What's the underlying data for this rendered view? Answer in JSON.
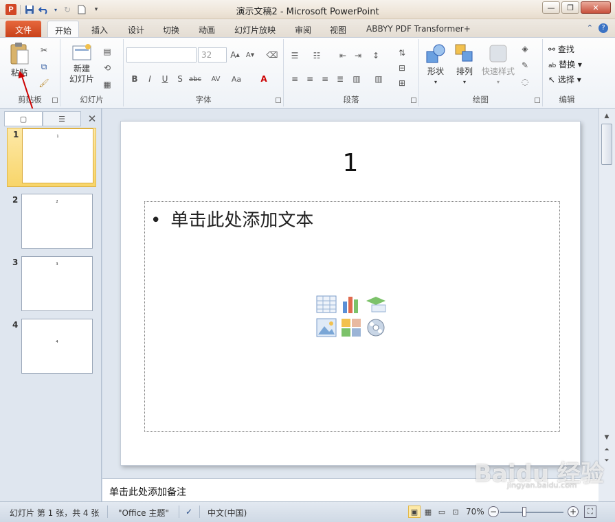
{
  "window": {
    "title": "演示文稿2 - Microsoft PowerPoint",
    "app_icon_letter": "P"
  },
  "tabs": {
    "file": "文件",
    "items": [
      "开始",
      "插入",
      "设计",
      "切换",
      "动画",
      "幻灯片放映",
      "审阅",
      "视图",
      "ABBYY PDF Transformer+"
    ],
    "active": "开始"
  },
  "ribbon": {
    "clipboard": {
      "label": "剪贴板",
      "paste": "粘贴"
    },
    "slides": {
      "label": "幻灯片",
      "new_slide_line1": "新建",
      "new_slide_line2": "幻灯片"
    },
    "font": {
      "label": "字体",
      "font_name": "",
      "font_size": "32"
    },
    "paragraph": {
      "label": "段落"
    },
    "drawing": {
      "label": "绘图",
      "shapes": "形状",
      "arrange": "排列",
      "quick_styles": "快速样式"
    },
    "editing": {
      "label": "编辑",
      "find": "查找",
      "replace": "替换",
      "select": "选择"
    }
  },
  "thumbnails": [
    {
      "num": "1",
      "title": "1",
      "selected": true
    },
    {
      "num": "2",
      "title": "2",
      "selected": false
    },
    {
      "num": "3",
      "title": "3",
      "selected": false
    },
    {
      "num": "4",
      "title": "4",
      "selected": false
    }
  ],
  "slide": {
    "title": "1",
    "bullet": "•",
    "placeholder_text": "单击此处添加文本"
  },
  "notes": {
    "placeholder": "单击此处添加备注"
  },
  "status": {
    "slide_info": "幻灯片 第 1 张，共 4 张",
    "theme": "\"Office 主题\"",
    "language": "中文(中国)",
    "zoom": "70%"
  },
  "watermark": {
    "text": "Baidu 经验",
    "sub": "jingyan.baidu.com"
  },
  "colors": {
    "file_tab": "#d04a20",
    "accent": "#2a4f8a",
    "selection": "#f8d56a"
  }
}
